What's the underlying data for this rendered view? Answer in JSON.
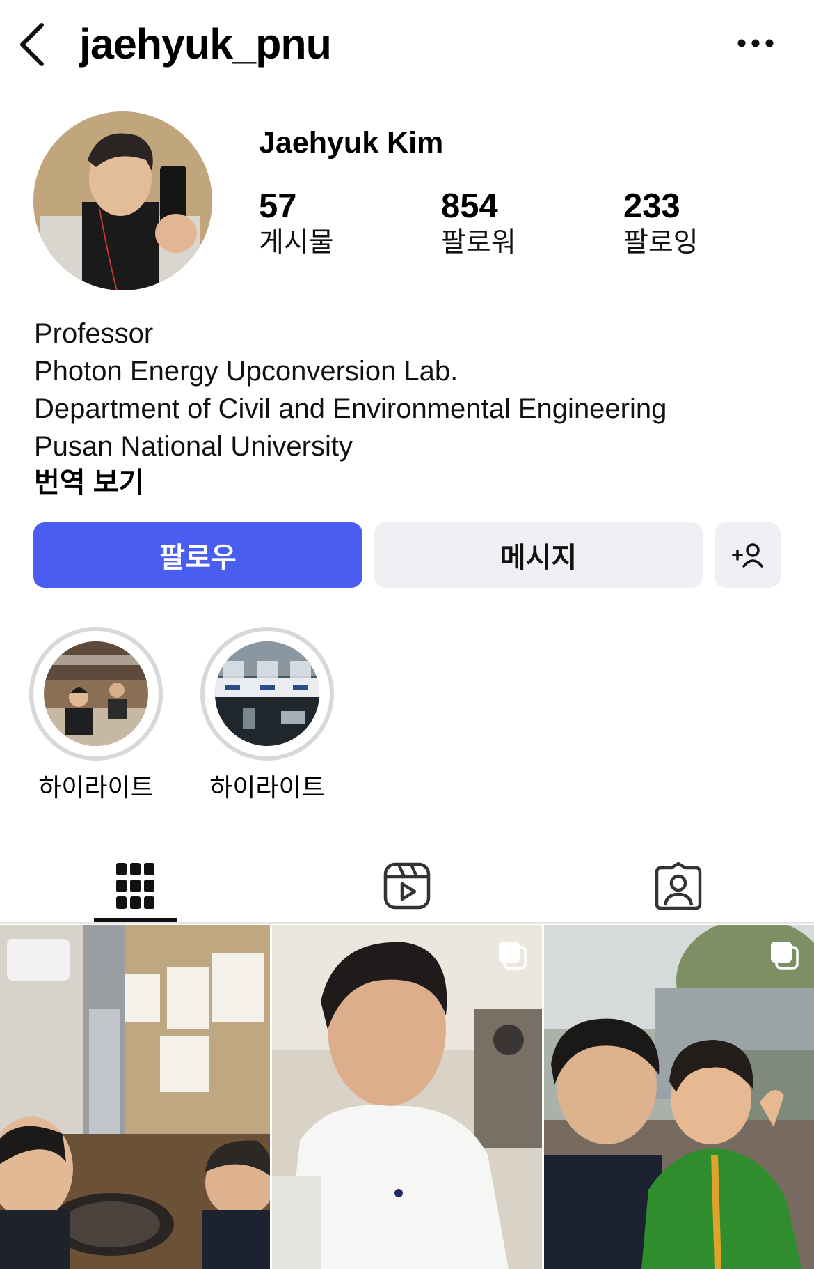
{
  "header": {
    "username": "jaehyuk_pnu",
    "back_icon": "chevron-left-icon",
    "more_icon": "ellipsis-icon"
  },
  "profile": {
    "display_name": "Jaehyuk Kim",
    "stats": [
      {
        "value": "57",
        "label": "게시물"
      },
      {
        "value": "854",
        "label": "팔로워"
      },
      {
        "value": "233",
        "label": "팔로잉"
      }
    ],
    "bio": [
      "Professor",
      "Photon Energy Upconversion Lab.",
      "Department of Civil and Environmental Engineering",
      "Pusan National University"
    ],
    "translate_label": "번역 보기"
  },
  "actions": {
    "follow_label": "팔로우",
    "message_label": "메시지",
    "add_user_icon": "add-person-icon"
  },
  "highlights": [
    {
      "label": "하이라이트"
    },
    {
      "label": "하이라이트"
    }
  ],
  "tabs": [
    {
      "name": "posts-grid",
      "icon": "grid-icon",
      "active": true
    },
    {
      "name": "reels",
      "icon": "reels-icon",
      "active": false
    },
    {
      "name": "tagged",
      "icon": "tagged-user-icon",
      "active": false
    }
  ],
  "posts": [
    {
      "multi": false
    },
    {
      "multi": true
    },
    {
      "multi": true
    }
  ],
  "colors": {
    "follow_button": "#4a5df1",
    "secondary_button": "#eff0f3",
    "highlight_ring": "#d6d8dc"
  }
}
